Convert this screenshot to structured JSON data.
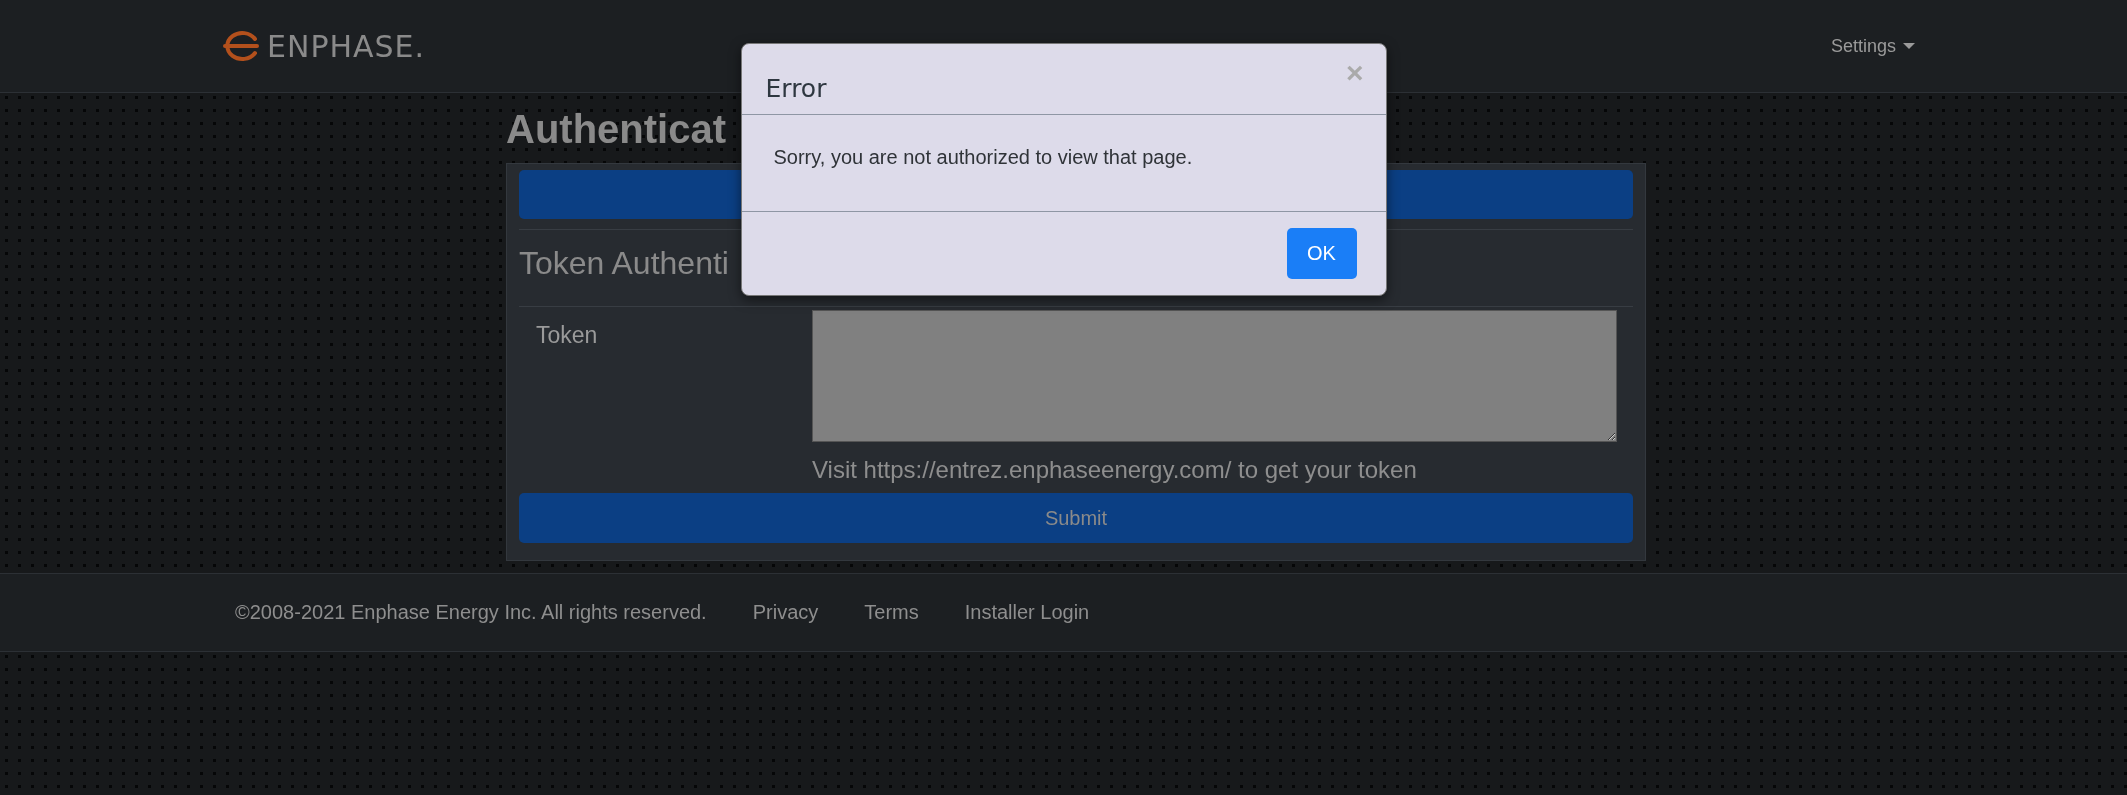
{
  "header": {
    "logo_text": "ENPHASE.",
    "settings_menu": "Settings"
  },
  "page": {
    "title": "Authenticat",
    "section_title": "Token Authenti",
    "token_label": "Token",
    "token_help": "Visit https://entrez.enphaseenergy.com/ to get your token",
    "submit_button": "Submit"
  },
  "dialog": {
    "title": "Error",
    "close": "×",
    "message": "Sorry, you are not authorized to view that page.",
    "ok_button": "OK"
  },
  "footer": {
    "copyright": "©2008-2021 Enphase Energy Inc. All rights reserved.",
    "links": [
      "Privacy",
      "Terms",
      "Installer Login"
    ]
  }
}
